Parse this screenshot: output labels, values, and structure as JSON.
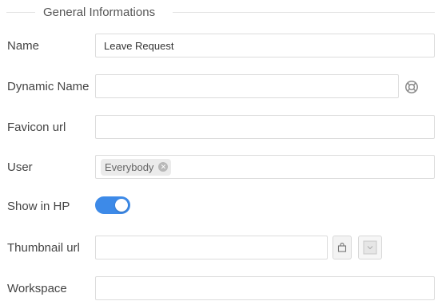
{
  "section": {
    "title": "General Informations"
  },
  "fields": {
    "name": {
      "label": "Name",
      "value": "Leave Request"
    },
    "dynamic_name": {
      "label": "Dynamic Name",
      "value": ""
    },
    "favicon_url": {
      "label": "Favicon url",
      "value": ""
    },
    "user": {
      "label": "User",
      "tags": [
        "Everybody"
      ]
    },
    "show_in_hp": {
      "label": "Show in HP",
      "enabled": true
    },
    "thumbnail_url": {
      "label": "Thumbnail url",
      "value": ""
    },
    "workspace": {
      "label": "Workspace",
      "value": ""
    }
  },
  "colors": {
    "toggle_on": "#3d8ae8",
    "border": "#dcdcdc",
    "tag_bg": "#ebebeb"
  },
  "icons": {
    "dynamic_name": "lifebuoy-icon",
    "thumbnail_upload": "bag-icon",
    "thumbnail_preview": "image-preview-icon",
    "tag_remove": "close-icon"
  }
}
